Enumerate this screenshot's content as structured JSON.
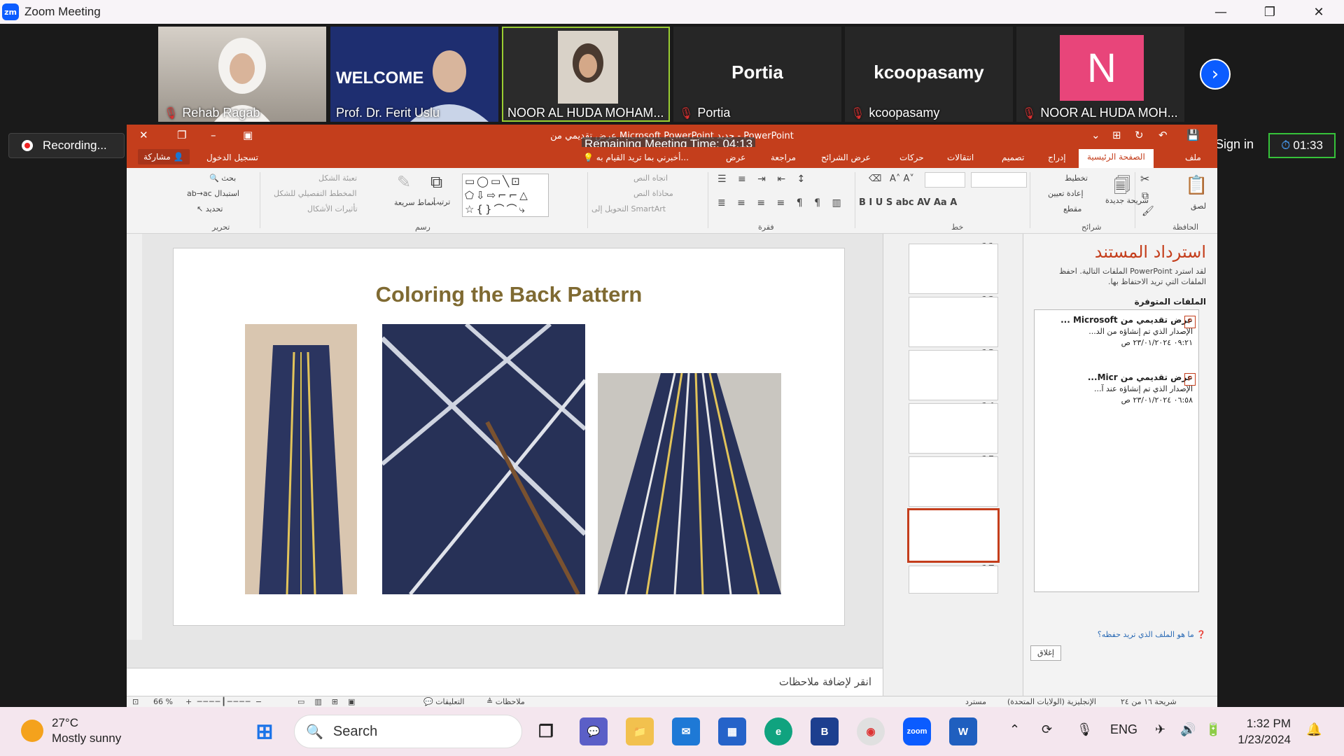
{
  "zoom": {
    "title": "Zoom Meeting",
    "logo": "zm",
    "recording": "Recording...",
    "sign_in": "Sign in",
    "timer": "01:33",
    "remaining": "Remaining Meeting Time: 04:13",
    "participants": [
      {
        "name": "Rehab Ragab",
        "muted": true
      },
      {
        "name": "Prof. Dr. Ferit Uslu",
        "muted": false
      },
      {
        "name": "NOOR AL HUDA MOHAM...",
        "muted": false
      },
      {
        "name": "Portia",
        "big": "Portia",
        "muted": true
      },
      {
        "name": "kcoopasamy",
        "big": "kcoopasamy",
        "muted": true
      },
      {
        "name": "NOOR AL HUDA MOH...",
        "big": "N",
        "muted": true
      }
    ],
    "welcome_text": "WELCOME"
  },
  "ppt": {
    "window_title": "عرض تقديمي من Microsoft PowerPoint جديد - PowerPoint",
    "tabs": [
      "ملف",
      "الصفحة الرئيسية",
      "إدراج",
      "تصميم",
      "انتقالات",
      "حركات",
      "عرض الشرائح",
      "مراجعة",
      "عرض"
    ],
    "tell_me": "أخبرني بما تريد القيام به...",
    "login": "تسجيل الدخول",
    "share": "مشاركة",
    "ribbon": {
      "paste": "لصق",
      "clipboard": "الحافظة",
      "new_slide": "شريحة جديدة",
      "layout": "تخطيط",
      "reset": "إعادة تعيين",
      "section": "مقطع",
      "slides": "شرائح",
      "font": "خط",
      "paragraph": "فقرة",
      "text_direction": "اتجاه النص",
      "align_text": "محاذاة النص",
      "smartart": "التحويل إلى SmartArt",
      "drawing": "رسم",
      "arrange": "ترتيب",
      "quick_styles": "أنماط سريعة",
      "shape_fill": "تعبئة الشكل",
      "shape_outline": "المخطط التفصيلي للشكل",
      "shape_effects": "تأثيرات الأشكال",
      "find": "بحث",
      "replace": "استبدال",
      "select": "تحديد",
      "editing": "تحرير"
    },
    "slide_title": "Coloring the Back Pattern",
    "notes_placeholder": "انقر لإضافة ملاحظات",
    "thumbnails": [
      11,
      12,
      13,
      14,
      15,
      16,
      17
    ],
    "selected_thumb": 16,
    "recovery": {
      "title": "استرداد المستند",
      "desc": "لقد استرد PowerPoint الملفات التالية. احفظ الملفات التي تريد الاحتفاظ بها.",
      "available": "الملفات المتوفرة",
      "files": [
        {
          "name": "عرض تقديمي من Microsoft ...",
          "line2": "الإصدار الذي تم إنشاؤه من الد...",
          "time": "٠٩:٢١ ٢٣/٠١/٢٠٢٤ ص"
        },
        {
          "name": "عرض تقديمي من Micr...",
          "line2": "الإصدار الذي تم إنشاؤه عند آ...",
          "time": "٠٦:٥٨ ٢٣/٠١/٢٠٢٤ ص"
        }
      ],
      "question": "ما هو الملف الذي تريد حفظه؟",
      "close": "إغلاق"
    },
    "status": {
      "slide_of": "شريحة ١٦ من ٢٤",
      "language": "الإنجليزية (الولايات المتحدة)",
      "recovered": "مسترد",
      "notes": "ملاحظات",
      "comments": "التعليقات",
      "zoom": "66 %"
    }
  },
  "taskbar": {
    "temp": "27°C",
    "weather": "Mostly sunny",
    "search": "Search",
    "lang": "ENG",
    "time": "1:32 PM",
    "date": "1/23/2024"
  }
}
